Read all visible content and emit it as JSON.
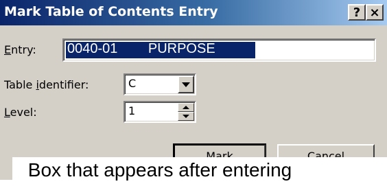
{
  "window": {
    "title": "Mark Table of Contents Entry",
    "help_label": "?",
    "close_label": "×"
  },
  "form": {
    "entry": {
      "label_prefix": "",
      "label_underlined": "E",
      "label_rest": "ntry:",
      "value": "0040-01        PURPOSE"
    },
    "table_identifier": {
      "label_prefix": "Table ",
      "label_underlined": "i",
      "label_rest": "dentifier:",
      "value": "C"
    },
    "level": {
      "label_prefix": "",
      "label_underlined": "L",
      "label_rest": "evel:",
      "value": "1"
    }
  },
  "buttons": {
    "mark": "Mark",
    "cancel": "Cancel"
  },
  "caption": {
    "text": "Box that appears after entering"
  },
  "colors": {
    "titlebar_start": "#0a246a",
    "titlebar_end": "#a6caf0",
    "selection": "#0a246a",
    "dialog_bg": "#d4d0c8"
  }
}
